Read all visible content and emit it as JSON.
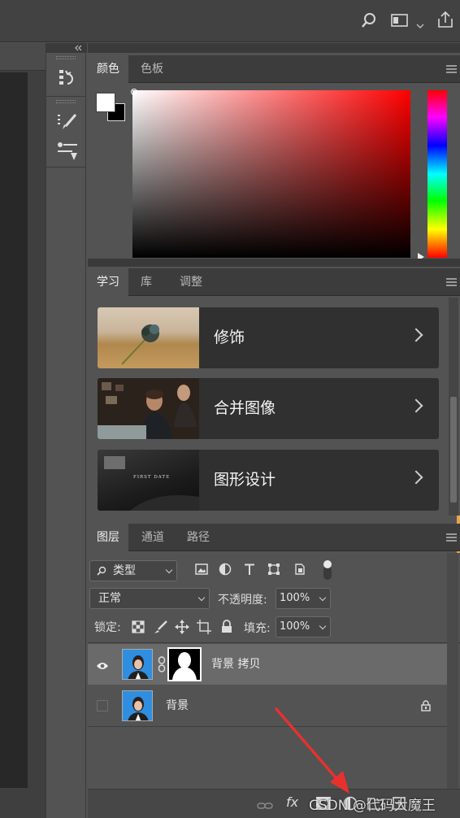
{
  "color_panel": {
    "tabs": [
      "颜色",
      "色板"
    ],
    "active_tab": "颜色",
    "foreground_color": "#ffffff",
    "background_color": "#000000",
    "hue_color": "#ff0000"
  },
  "learn_panel": {
    "tabs": [
      "学习",
      "库",
      "调整"
    ],
    "active_tab": "学习",
    "cards": [
      {
        "title": "修饰"
      },
      {
        "title": "合并图像"
      },
      {
        "title": "图形设计",
        "thumbnail_text": "FIRST DATE"
      }
    ]
  },
  "layers_panel": {
    "tabs": [
      "图层",
      "通道",
      "路径"
    ],
    "active_tab": "图层",
    "filter_kind": "类型",
    "blend_mode": "正常",
    "opacity_label": "不透明度:",
    "opacity_value": "100%",
    "lock_label": "锁定:",
    "fill_label": "填充:",
    "fill_value": "100%",
    "layers": [
      {
        "name": "背景 拷贝",
        "visible": true,
        "has_mask": true,
        "selected": true
      },
      {
        "name": "背景",
        "visible": false,
        "locked": true,
        "selected": false
      }
    ],
    "fx_label": "fx"
  },
  "watermark": "CSDN @代码大魔王",
  "colors": {
    "panel_bg": "#535353",
    "header_bg": "#3c3c3c",
    "selected_row": "#6a6a6a",
    "annotation_arrow": "#e8312d"
  }
}
